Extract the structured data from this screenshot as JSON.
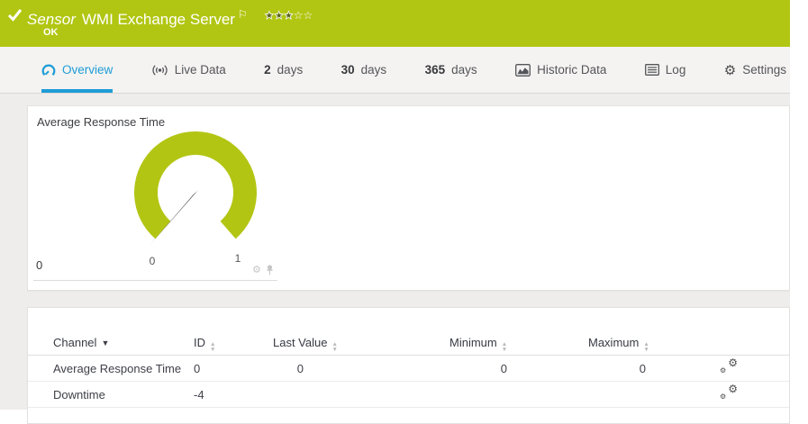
{
  "colors": {
    "brand_green": "#b1c612",
    "accent_blue": "#1e9cd7",
    "gauge_arc": "#b3c513",
    "needle_gray": "#6f6f6f"
  },
  "header": {
    "kind_label": "Sensor",
    "title": "WMI Exchange Server",
    "status": "OK",
    "rating": {
      "filled": 3,
      "total": 5
    }
  },
  "tabs": [
    {
      "label": "Overview",
      "active": true
    },
    {
      "label": "Live Data"
    },
    {
      "number": "2",
      "label": "days"
    },
    {
      "number": "30",
      "label": "days"
    },
    {
      "number": "365",
      "label": "days"
    },
    {
      "label": "Historic Data"
    },
    {
      "label": "Log"
    },
    {
      "label": "Settings"
    }
  ],
  "gauge": {
    "title": "Average Response Time",
    "current_value": "0",
    "scale_min": "0",
    "scale_max": "1"
  },
  "table": {
    "columns": [
      {
        "label": "Channel",
        "sort": "desc-active"
      },
      {
        "label": "ID",
        "sort": "both"
      },
      {
        "label": "Last Value",
        "sort": "both"
      },
      {
        "label": "Minimum",
        "sort": "both"
      },
      {
        "label": "Maximum",
        "sort": "both"
      }
    ],
    "rows": [
      {
        "channel": "Average Response Time",
        "id": "0",
        "last_value": "0",
        "minimum": "0",
        "maximum": "0"
      },
      {
        "channel": "Downtime",
        "id": "-4",
        "last_value": "",
        "minimum": "",
        "maximum": ""
      }
    ]
  },
  "icons": {
    "gear": "⚙",
    "flag": "⚐",
    "star_filled": "★",
    "star_empty": "☆",
    "sort_desc": "▼",
    "sort_up": "▲",
    "sort_down": "▼"
  }
}
